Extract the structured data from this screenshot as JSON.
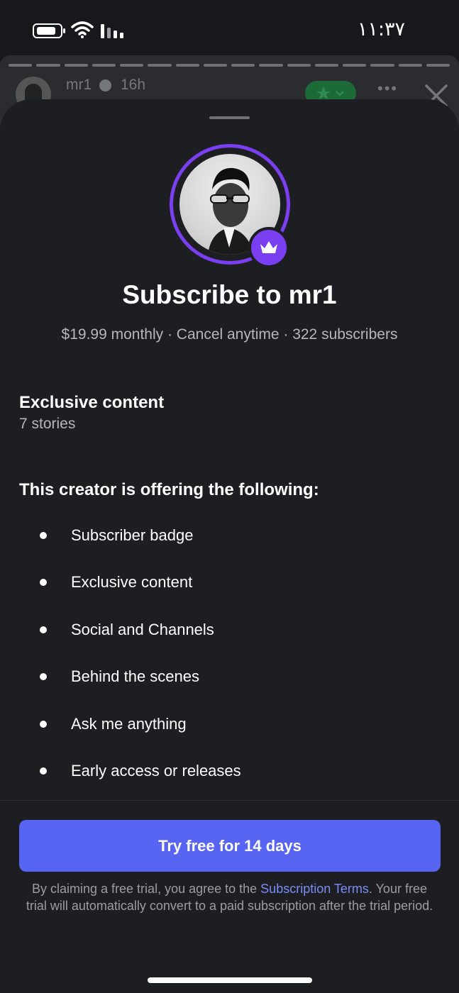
{
  "status_bar": {
    "time": "١١:٣٧"
  },
  "story": {
    "username": "mr1",
    "age": "16h"
  },
  "sheet": {
    "title": "Subscribe to mr1",
    "subtitle": "$19.99 monthly · Cancel anytime · 322 subscribers",
    "exclusive": {
      "heading": "Exclusive content",
      "count": "7 stories"
    },
    "offering_heading": "This creator is offering the following:",
    "benefits": [
      "Subscriber badge",
      "Exclusive content",
      "Social and Channels",
      "Behind the scenes",
      "Ask me anything",
      "Early access or releases"
    ],
    "cta_label": "Try free for 14 days",
    "legal": {
      "prefix": "By claiming a free trial, you agree to the ",
      "link": "Subscription Terms",
      "suffix": ". Your free trial will automatically convert to a paid subscription after the trial period."
    }
  },
  "colors": {
    "accent": "#7b3ff2",
    "cta": "#5865f2",
    "link": "#7b8cf7",
    "background": "#1c1e22"
  },
  "icons": [
    "battery-icon",
    "wifi-icon",
    "signal-icon",
    "verified-icon",
    "star-icon",
    "more-icon",
    "close-icon",
    "crown-icon"
  ]
}
